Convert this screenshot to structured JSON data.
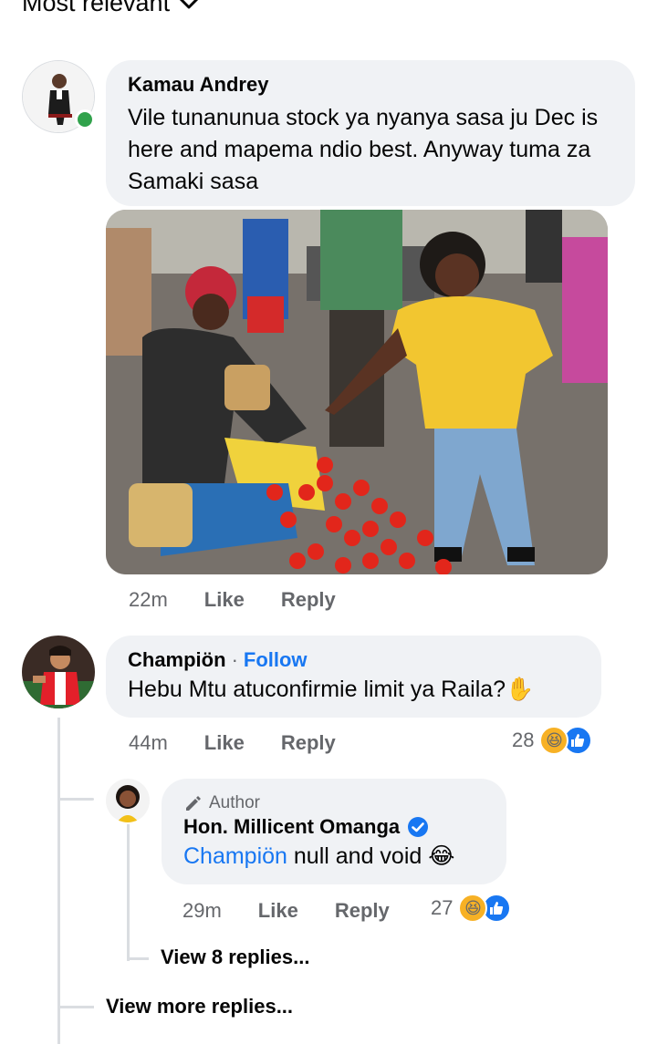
{
  "sort": {
    "label": "Most relevant"
  },
  "comments": [
    {
      "author": "Kamau Andrey",
      "text": "Vile tunanunua stock ya nyanya sasa ju Dec is here and mapema ndio best. Anyway tuma za Samaki sasa",
      "time": "22m",
      "like_label": "Like",
      "reply_label": "Reply"
    },
    {
      "author": "Champiön",
      "follow_label": "Follow",
      "text": "Hebu Mtu atuconfirmie limit ya Raila?✋",
      "time": "44m",
      "like_label": "Like",
      "reply_label": "Reply",
      "reaction_count": "28"
    }
  ],
  "reply": {
    "badge": "Author",
    "author": "Hon. Millicent Omanga",
    "mention": "Champiön",
    "text": " null and void 😂",
    "time": "29m",
    "like_label": "Like",
    "reply_label": "Reply",
    "reaction_count": "27"
  },
  "view_replies_label": "View 8 replies...",
  "view_more_label": "View more replies...",
  "colors": {
    "bubble": "#f0f2f5",
    "link": "#1877f2",
    "meta": "#65676b",
    "online": "#31a24c"
  }
}
